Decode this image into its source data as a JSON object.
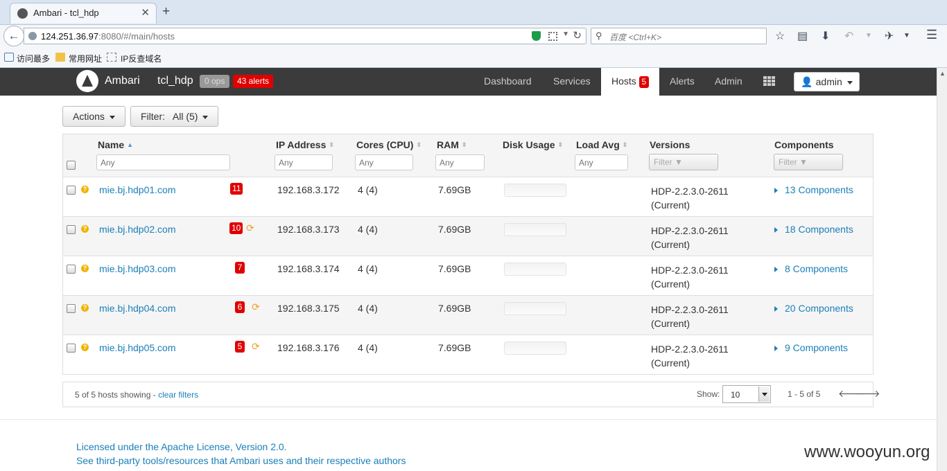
{
  "browser": {
    "tab_title": "Ambari - tcl_hdp",
    "url_host": "124.251.36.97",
    "url_rest": ":8080/#/main/hosts",
    "search_placeholder": "百度 <Ctrl+K>",
    "bookmarks": [
      "访问最多",
      "常用网址",
      "IP反查域名"
    ]
  },
  "topnav": {
    "brand": "Ambari",
    "cluster": "tcl_hdp",
    "ops": "0 ops",
    "alerts": "43 alerts",
    "links": {
      "dashboard": "Dashboard",
      "services": "Services",
      "hosts": "Hosts",
      "alerts": "Alerts",
      "admin": "Admin"
    },
    "hosts_count": "5",
    "user": "admin"
  },
  "toolbar": {
    "actions": "Actions",
    "filter": "Filter:   All (5)"
  },
  "table": {
    "headers": {
      "name": "Name",
      "ip": "IP Address",
      "cores": "Cores (CPU)",
      "ram": "RAM",
      "disk": "Disk Usage",
      "load": "Load Avg",
      "versions": "Versions",
      "components": "Components"
    },
    "filter_placeholder": "Any",
    "filter_button": "Filter",
    "rows": [
      {
        "name": "mie.bj.hdp01.com",
        "alerts": "11",
        "restart": false,
        "ip": "192.168.3.172",
        "cores": "4 (4)",
        "ram": "7.69GB",
        "version": "HDP-2.2.3.0-2611",
        "version_state": "(Current)",
        "components": "13 Components"
      },
      {
        "name": "mie.bj.hdp02.com",
        "alerts": "10",
        "restart": true,
        "ip": "192.168.3.173",
        "cores": "4 (4)",
        "ram": "7.69GB",
        "version": "HDP-2.2.3.0-2611",
        "version_state": "(Current)",
        "components": "18 Components"
      },
      {
        "name": "mie.bj.hdp03.com",
        "alerts": "7",
        "restart": false,
        "ip": "192.168.3.174",
        "cores": "4 (4)",
        "ram": "7.69GB",
        "version": "HDP-2.2.3.0-2611",
        "version_state": "(Current)",
        "components": "8 Components"
      },
      {
        "name": "mie.bj.hdp04.com",
        "alerts": "6",
        "restart": true,
        "ip": "192.168.3.175",
        "cores": "4 (4)",
        "ram": "7.69GB",
        "version": "HDP-2.2.3.0-2611",
        "version_state": "(Current)",
        "components": "20 Components"
      },
      {
        "name": "mie.bj.hdp05.com",
        "alerts": "5",
        "restart": true,
        "ip": "192.168.3.176",
        "cores": "4 (4)",
        "ram": "7.69GB",
        "version": "HDP-2.2.3.0-2611",
        "version_state": "(Current)",
        "components": "9 Components"
      }
    ]
  },
  "footer": {
    "showing": "5 of 5 hosts showing - ",
    "clear_filters": "clear filters",
    "show_label": "Show:",
    "page_size": "10",
    "range": "1 - 5 of 5"
  },
  "license": {
    "line1": "Licensed under the Apache License, Version 2.0.",
    "line2": "See third-party tools/resources that Ambari uses and their respective authors"
  },
  "watermark": "www.wooyun.org",
  "colors": {
    "nav_bg": "#3b3b3b",
    "alert_red": "#e10000",
    "link_blue": "#1a7fb8",
    "warning_yellow": "#f0b400",
    "restart_orange": "#f0a030"
  }
}
